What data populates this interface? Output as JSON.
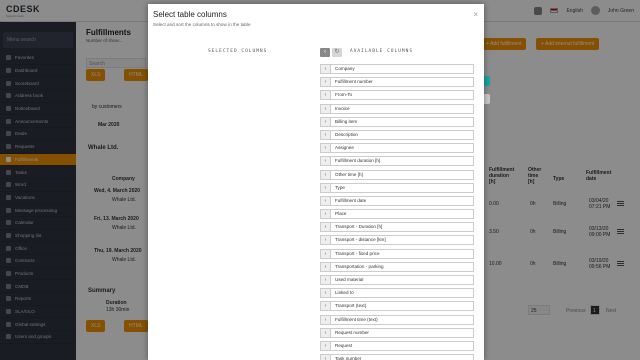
{
  "app": {
    "logo_text": "CDESK",
    "logo_sub": "Support desk",
    "language": "English",
    "user": "John Green"
  },
  "sidebar": {
    "search_placeholder": "Menu search",
    "items": [
      {
        "label": "Favorites"
      },
      {
        "label": "Dashboard"
      },
      {
        "label": "Scoreboard"
      },
      {
        "label": "Address book"
      },
      {
        "label": "Noticeboard"
      },
      {
        "label": "Announcements"
      },
      {
        "label": "Deals"
      },
      {
        "label": "Requests"
      },
      {
        "label": "Fulfillments",
        "active": true
      },
      {
        "label": "Tasks"
      },
      {
        "label": "Word"
      },
      {
        "label": "Vacations"
      },
      {
        "label": "Message processing"
      },
      {
        "label": "Calendar"
      },
      {
        "label": "Shopping list"
      },
      {
        "label": "Office"
      },
      {
        "label": "Contracts"
      },
      {
        "label": "Products"
      },
      {
        "label": "CMDB"
      },
      {
        "label": "Reports"
      },
      {
        "label": "SLA/OLO"
      },
      {
        "label": "Global settings"
      },
      {
        "label": "Users and groups"
      }
    ]
  },
  "background": {
    "title": "Fulfillments",
    "subtitle": "Number of show...",
    "add_fulfillment": "+ Add fulfillment",
    "add_internal": "+ Add internal fulfillment",
    "search_placeholder": "Search",
    "xls_label": "XLS",
    "html_label": "HTML",
    "by_customers": "by customers",
    "month": "Mar 2020",
    "company_group": "Whale Ltd.",
    "company_header": "Company",
    "rows": [
      {
        "date": "Wed, 4. March 2020",
        "company": "Whale Ltd.",
        "duration": "0.00",
        "other": "0h",
        "type": "Billing",
        "fdate": "03/04/20 07:21 PM"
      },
      {
        "date": "Fri, 13. March 2020",
        "company": "Whale Ltd.",
        "duration": "3.50",
        "other": "0h",
        "type": "Billing",
        "fdate": "03/13/20 09:00 PM"
      },
      {
        "date": "Thu, 19. March 2020",
        "company": "Whale Ltd.",
        "duration": "10.00",
        "other": "0h",
        "type": "Billing",
        "fdate": "03/19/20 09:56 PM"
      }
    ],
    "col_headers": {
      "duration": "Fulfillment duration [h]",
      "other": "Other time [h]",
      "type": "Type",
      "fdate": "Fulfillment date"
    },
    "summary_title": "Summary",
    "summary_duration_label": "Duration",
    "summary_duration_value": "13h 30min",
    "pager": {
      "per_page": "25",
      "previous": "Previous",
      "page": "1",
      "next": "Next"
    }
  },
  "modal": {
    "title": "Select table columns",
    "subtitle": "Select and sort the columns to show in the table",
    "close": "×",
    "selected_heading": "SELECTED COLUMNS",
    "available_heading": "AVAILABLE COLUMNS",
    "available": [
      "Company",
      "Fulfillment number",
      "From-To",
      "Invoice",
      "Billing item",
      "Description",
      "Assignee",
      "Fulfillment duration [h]",
      "Other time [h]",
      "Type",
      "Fulfillment date",
      "Place",
      "Transport - Duration [h]",
      "Transport - distance [km]",
      "Transport - fixed price",
      "Transportation - parking",
      "Used material",
      "Linked to",
      "Transport (text)",
      "Fulfillment time (text)",
      "Request number",
      "Request",
      "Task number"
    ]
  }
}
